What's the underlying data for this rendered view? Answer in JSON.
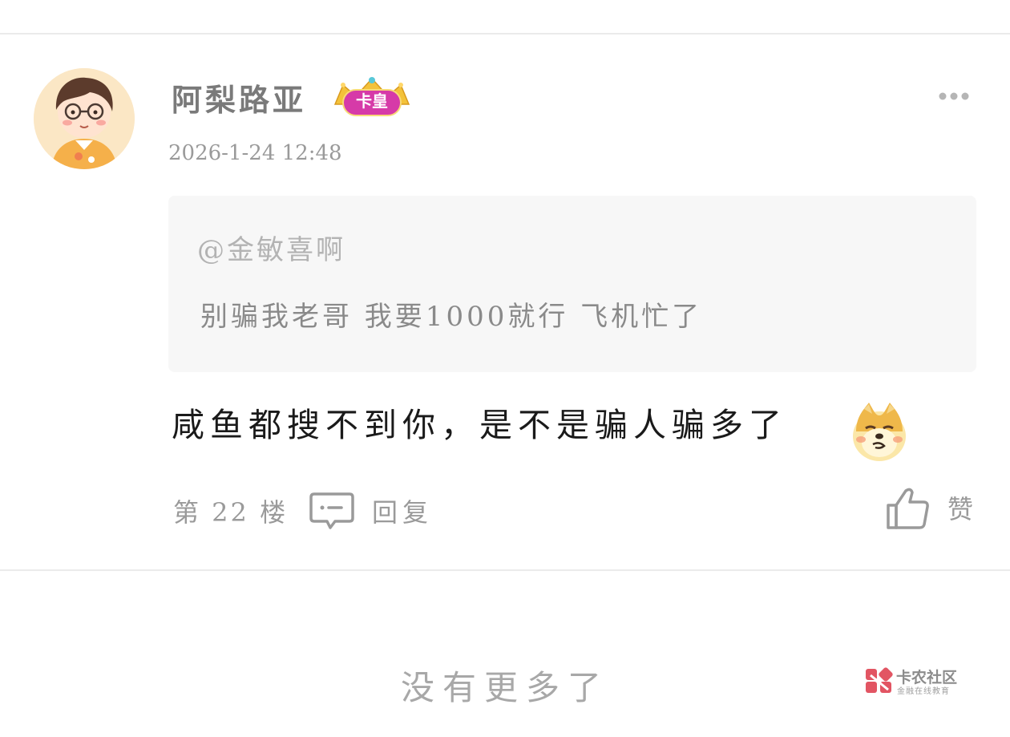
{
  "post": {
    "username": "阿梨路亚",
    "badge": "卡皇",
    "timestamp": "2026-1-24 12:48",
    "quote": {
      "mention": "@金敏喜啊",
      "text": "别骗我老哥 我要1000就行 飞机忙了"
    },
    "comment": "咸鱼都搜不到你，是不是骗人骗多了",
    "emoji": "doge-emoji",
    "floor": "第 22 楼",
    "reply_label": "回复",
    "like_label": "赞"
  },
  "footer": {
    "no_more": "没有更多了"
  },
  "watermark": {
    "title": "卡农社区",
    "subtitle": "金融在线教育"
  },
  "colors": {
    "badge": "#d63aa8",
    "crown": "#f3c23a",
    "watermark_logo": "#e25563",
    "divider": "#ebebeb"
  }
}
